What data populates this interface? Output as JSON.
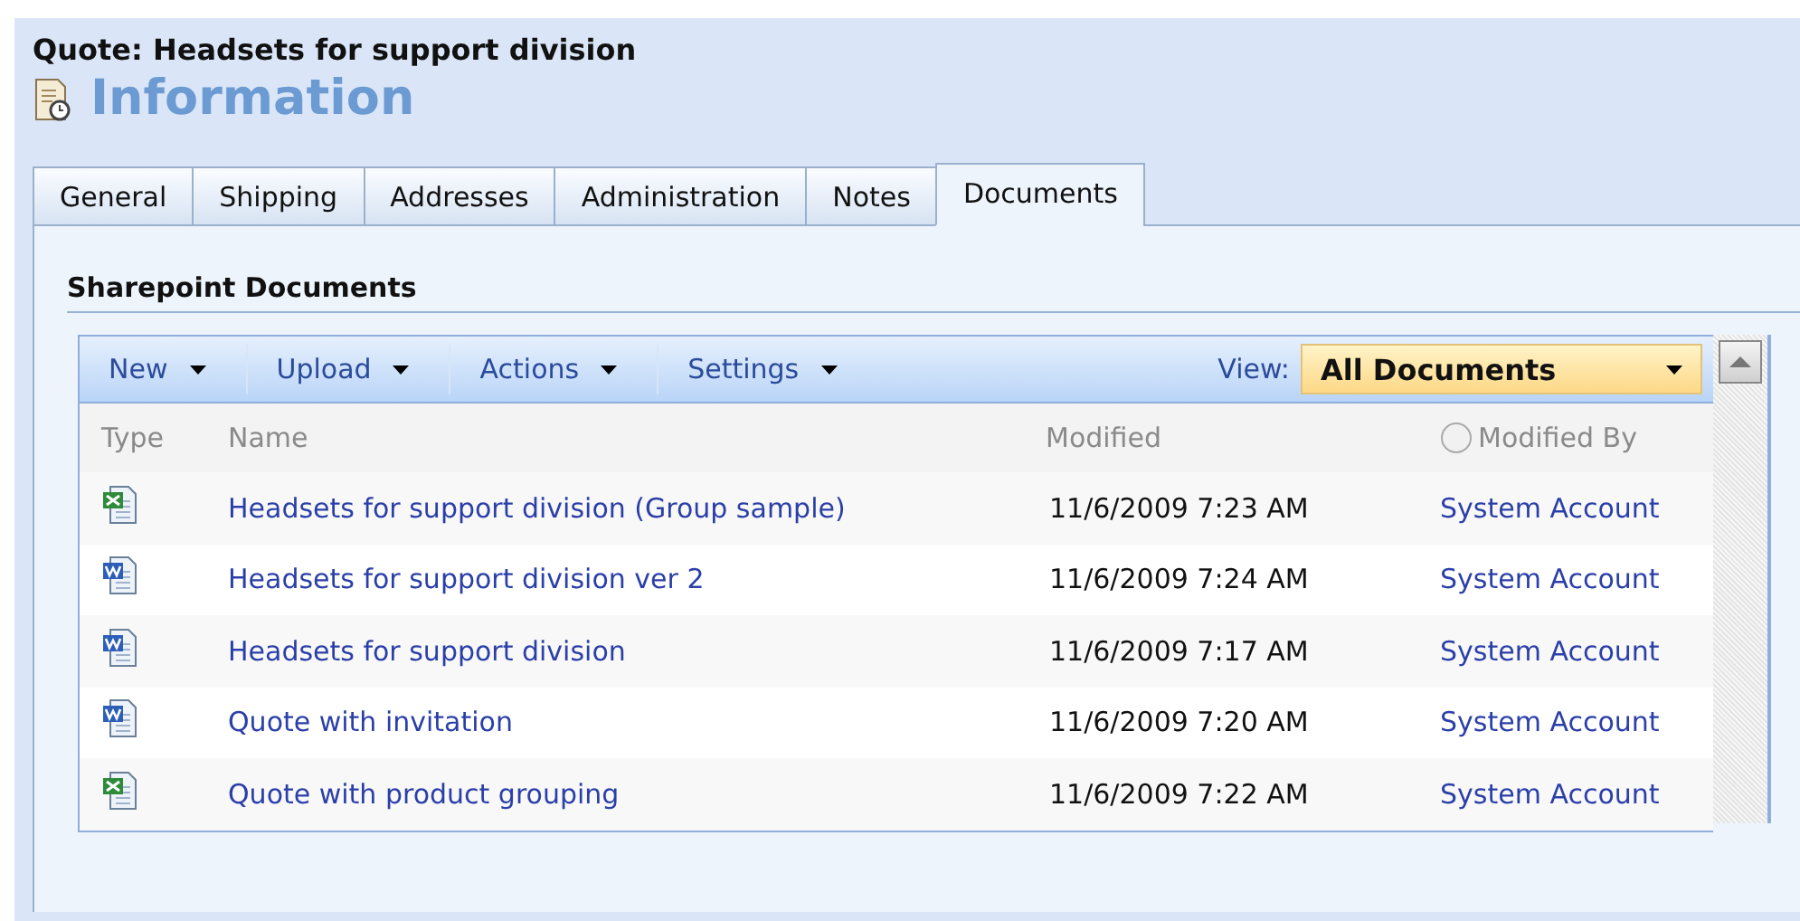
{
  "record_title": "Quote: Headsets for support division",
  "form_title": "Information",
  "tabs": [
    {
      "label": "General",
      "selected": false
    },
    {
      "label": "Shipping",
      "selected": false
    },
    {
      "label": "Addresses",
      "selected": false
    },
    {
      "label": "Administration",
      "selected": false
    },
    {
      "label": "Notes",
      "selected": false
    },
    {
      "label": "Documents",
      "selected": true
    }
  ],
  "section_title": "Sharepoint Documents",
  "toolbar": {
    "menus": [
      "New",
      "Upload",
      "Actions",
      "Settings"
    ],
    "view_label": "View:",
    "view_value": "All Documents"
  },
  "table": {
    "columns": [
      "Type",
      "Name",
      "Modified",
      "Modified By"
    ],
    "rows": [
      {
        "kind": "excel",
        "name": "Headsets for support division (Group sample)",
        "modified": "11/6/2009 7:23 AM",
        "modified_by": "System Account"
      },
      {
        "kind": "word",
        "name": "Headsets for support division ver 2",
        "modified": "11/6/2009 7:24 AM",
        "modified_by": "System Account"
      },
      {
        "kind": "word",
        "name": "Headsets for support division",
        "modified": "11/6/2009 7:17 AM",
        "modified_by": "System Account"
      },
      {
        "kind": "word",
        "name": "Quote with invitation",
        "modified": "11/6/2009 7:20 AM",
        "modified_by": "System Account"
      },
      {
        "kind": "excel",
        "name": "Quote with product grouping",
        "modified": "11/6/2009 7:22 AM",
        "modified_by": "System Account"
      }
    ]
  }
}
